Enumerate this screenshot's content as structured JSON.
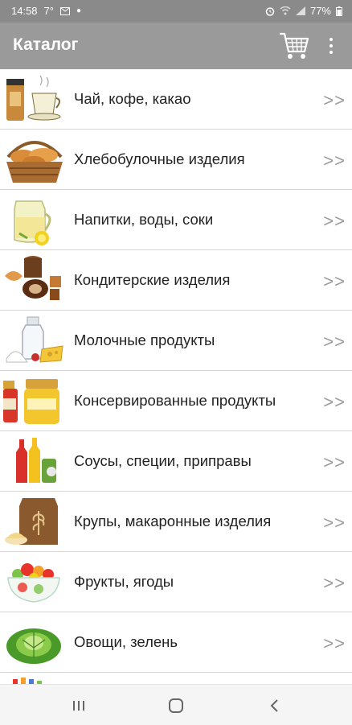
{
  "status": {
    "time": "14:58",
    "temp": "7°",
    "battery": "77%"
  },
  "appbar": {
    "title": "Каталог"
  },
  "catalog": {
    "items": [
      {
        "label": "Чай, кофе, какао",
        "icon": "tea-coffee-icon"
      },
      {
        "label": "Хлебобулочные изделия",
        "icon": "bread-basket-icon"
      },
      {
        "label": "Напитки, воды, соки",
        "icon": "juice-jug-icon"
      },
      {
        "label": "Кондитерские изделия",
        "icon": "pastry-icon"
      },
      {
        "label": "Молочные продукты",
        "icon": "milk-cheese-icon"
      },
      {
        "label": "Консервированные продукты",
        "icon": "jars-icon"
      },
      {
        "label": "Соусы, специи, приправы",
        "icon": "sauce-bottles-icon"
      },
      {
        "label": "Крупы, макаронные изделия",
        "icon": "flour-sack-icon"
      },
      {
        "label": "Фрукты, ягоды",
        "icon": "fruit-bowl-icon"
      },
      {
        "label": "Овощи, зелень",
        "icon": "cabbage-icon"
      }
    ],
    "chevron": ">>"
  },
  "colors": {
    "appbar": "#9a9a9a",
    "statusbar": "#8a8a8a"
  }
}
